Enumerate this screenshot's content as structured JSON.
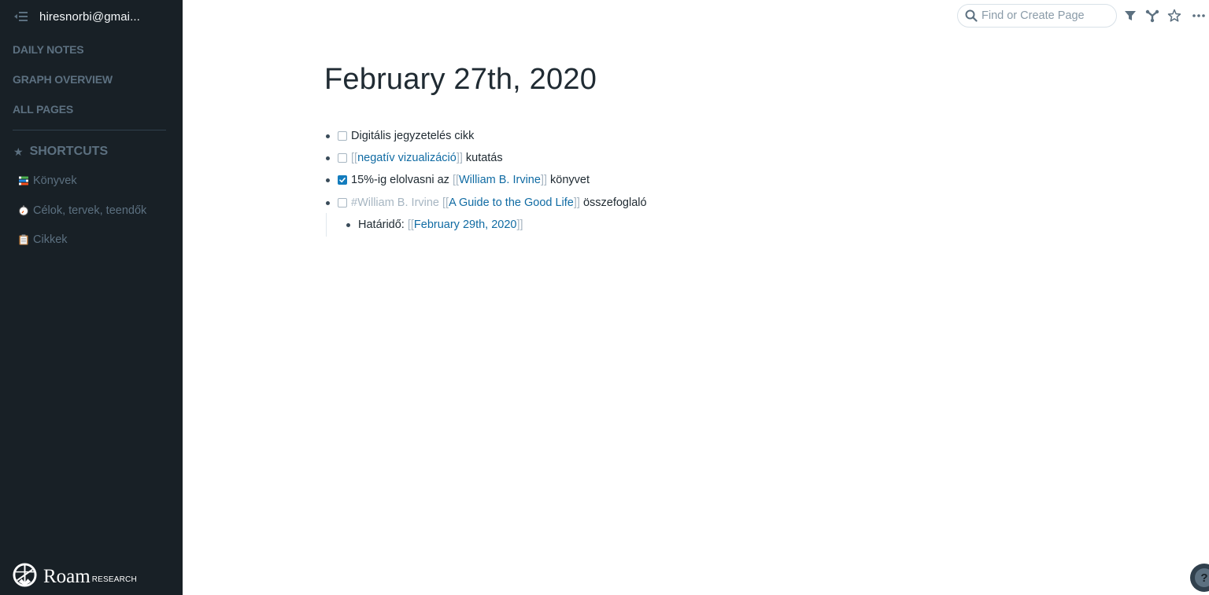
{
  "sidebar": {
    "user": "hiresnorbi@gmai...",
    "nav": [
      {
        "label": "DAILY NOTES"
      },
      {
        "label": "GRAPH OVERVIEW"
      },
      {
        "label": "ALL PAGES"
      }
    ],
    "shortcuts_header": "SHORTCUTS",
    "shortcuts_icon": "★",
    "shortcuts": [
      {
        "label": "Könyvek",
        "icon": "books-icon"
      },
      {
        "label": "Célok, tervek, teendők",
        "icon": "stopwatch-icon"
      },
      {
        "label": "Cikkek",
        "icon": "clipboard-icon"
      }
    ],
    "logo": {
      "word": "Roam",
      "sub": "RESEARCH"
    }
  },
  "topbar": {
    "search_placeholder": "Find or Create Page",
    "search_value": "",
    "icons": [
      "filter-icon",
      "graph-icon",
      "star-icon",
      "more-icon"
    ]
  },
  "page": {
    "title": "February 27th, 2020",
    "blocks": [
      {
        "checked": false,
        "text": "Digitális jegyzetelés cikk"
      },
      {
        "checked": false,
        "link": "negatív vizualizáció",
        "suffix": "kutatás"
      },
      {
        "checked": true,
        "prefix": "15%-ig elolvasni az",
        "link": "William B. Irvine",
        "suffix": "könyvet"
      },
      {
        "checked": false,
        "tag": "#William B. Irvine",
        "link": "A Guide to the Good Life",
        "suffix": "összefoglaló",
        "children": [
          {
            "prefix": "Határidő:",
            "link": "February 29th, 2020"
          }
        ]
      }
    ],
    "bracket_open": "[[",
    "bracket_close": "]]"
  },
  "help": {
    "label": "?"
  },
  "colors": {
    "sidebar_bg": "#182026",
    "sidebar_text": "#5c7080",
    "link": "#106ba3",
    "bracket": "#a7b6c2",
    "checkbox_checked": "#137cbd"
  }
}
